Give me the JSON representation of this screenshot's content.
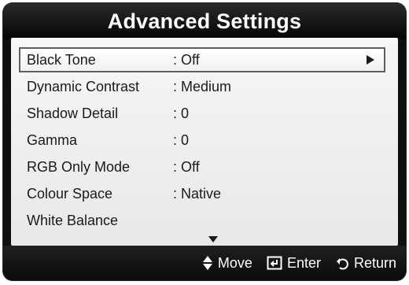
{
  "header": {
    "title": "Advanced Settings"
  },
  "menu": {
    "items": [
      {
        "label": "Black Tone",
        "value": ": Off"
      },
      {
        "label": "Dynamic Contrast",
        "value": ": Medium"
      },
      {
        "label": "Shadow Detail",
        "value": ": 0"
      },
      {
        "label": "Gamma",
        "value": ": 0"
      },
      {
        "label": "RGB Only Mode",
        "value": ": Off"
      },
      {
        "label": "Colour Space",
        "value": ": Native"
      },
      {
        "label": "White Balance",
        "value": ""
      }
    ],
    "selected_index": 0
  },
  "footer": {
    "move_label": "Move",
    "enter_label": "Enter",
    "return_label": "Return",
    "move_icon": "up-down-arrows-icon",
    "enter_icon": "enter-icon",
    "return_icon": "return-icon"
  },
  "colors": {
    "frame": "#0f0f0f",
    "panel": "#f0f0f0",
    "selection_border": "#5e5e5e",
    "text": "#1a1a1a",
    "footer_text": "#ffffff"
  }
}
